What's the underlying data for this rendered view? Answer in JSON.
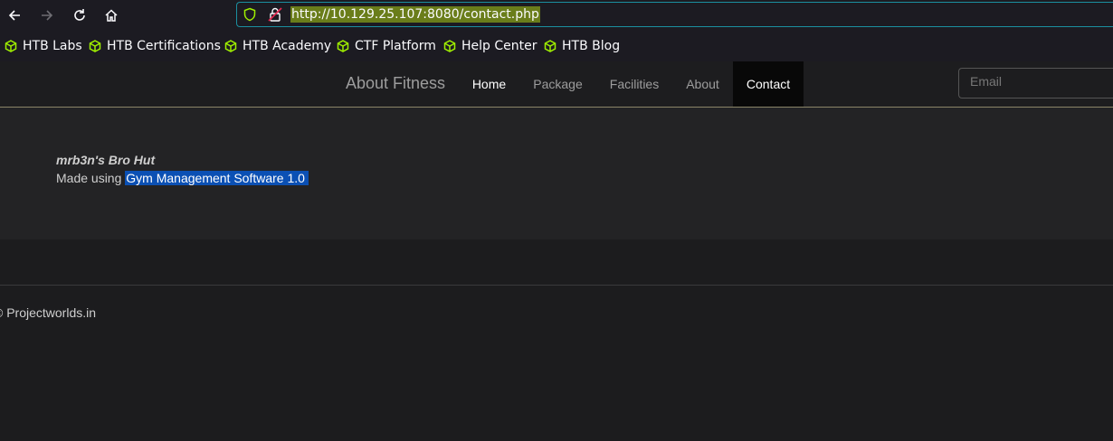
{
  "browser": {
    "url": "http://10.129.25.107:8080/contact.php",
    "bookmarks": [
      {
        "label": "HTB Labs"
      },
      {
        "label": "HTB Certifications"
      },
      {
        "label": "HTB Academy"
      },
      {
        "label": "CTF Platform"
      },
      {
        "label": "Help Center"
      },
      {
        "label": "HTB Blog"
      }
    ],
    "colors": {
      "accent": "#1b8fa0",
      "bookmark_icon": "#9fef00",
      "lock_warning": "#e22850"
    }
  },
  "site": {
    "brand": "About Fitness",
    "nav": [
      {
        "label": "Home"
      },
      {
        "label": "Package"
      },
      {
        "label": "Facilities"
      },
      {
        "label": "About"
      },
      {
        "label": "Contact"
      }
    ],
    "email_placeholder": "Email",
    "content": {
      "name": "mrb3n's Bro Hut",
      "made_using_prefix": "Made using",
      "software": "Gym Management Software 1.0"
    },
    "footer": "© Projectworlds.in"
  }
}
